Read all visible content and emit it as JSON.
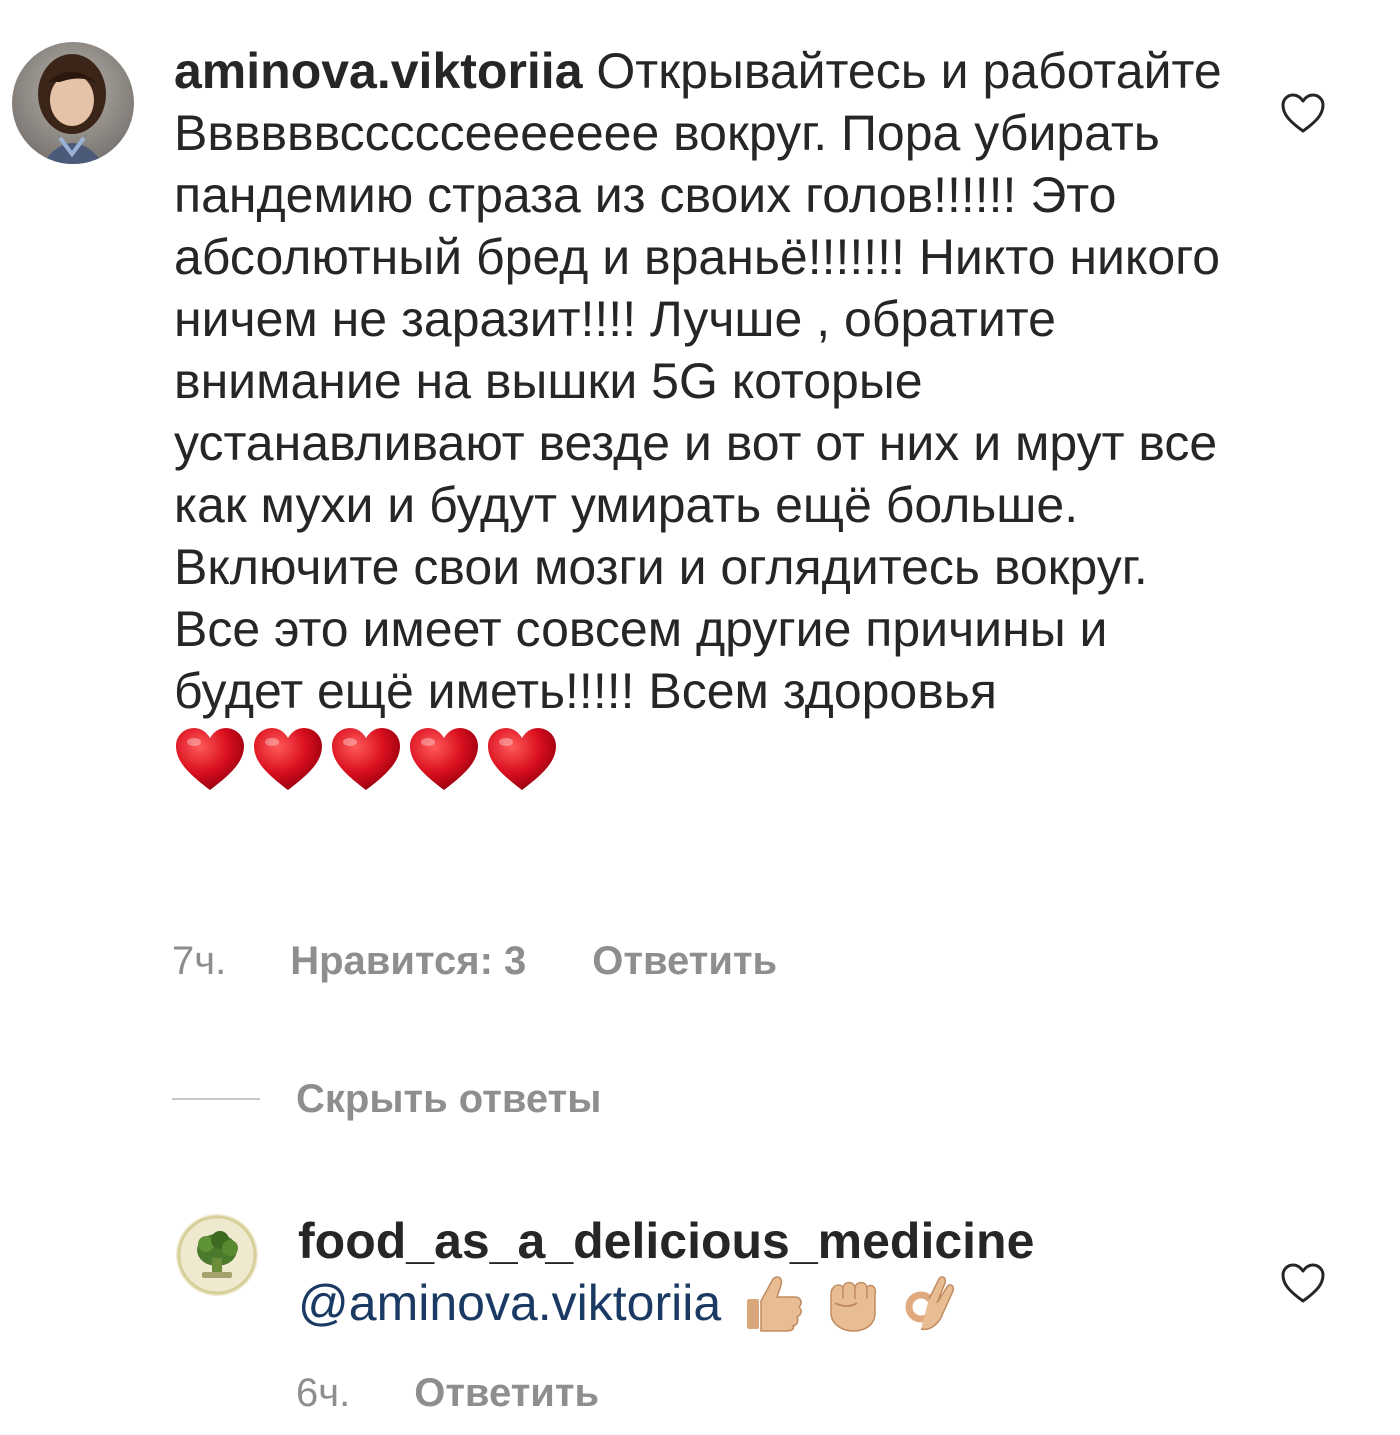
{
  "comment": {
    "username": "aminova.viktoriia",
    "text": "Открывайтесь и работайте Ввввввсссссеееееее вокруг. Пора убирать пандемию страза из своих голов!!!!!! Это абсолютный бред и враньё!!!!!!! Никто никого ничем не заразит!!!! Лучше , обратите внимание на вышки 5G которые устанавливают везде и вот от них и мрут все как мухи и будут умирать ещё больше. Включите свои мозги и оглядитесь вокруг. Все это имеет совсем другие причины и будет ещё иметь!!!!! Всем здоровья",
    "emojis": [
      "red-heart",
      "red-heart",
      "red-heart",
      "red-heart",
      "red-heart"
    ],
    "time": "7ч.",
    "likes": "Нравится: 3",
    "reply_label": "Ответить"
  },
  "replies_toggle": {
    "label": "Скрыть ответы"
  },
  "reply": {
    "username": "food_as_a_delicious_medicine",
    "mention": "@aminova.viktoriia",
    "emojis": [
      "thumbs-up",
      "raised-fist",
      "ok-hand"
    ],
    "time": "6ч.",
    "reply_label": "Ответить"
  },
  "colors": {
    "text": "#262626",
    "secondary": "#8e8e8e",
    "mention": "#1a3a63",
    "heart": "#d0021b"
  },
  "icons": {
    "like": "heart-outline-icon"
  }
}
